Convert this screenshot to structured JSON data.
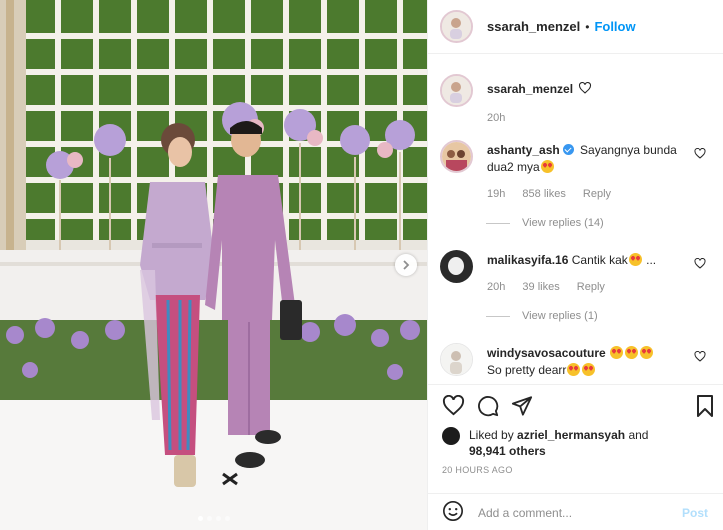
{
  "post": {
    "image_alt": "Photo of couple in lavender outfits in front of floral backdrop",
    "carousel": {
      "current": 1,
      "total": 4
    }
  },
  "header": {
    "username": "ssarah_menzel",
    "separator": "•",
    "follow_label": "Follow"
  },
  "caption": {
    "username": "ssarah_menzel",
    "time": "20h"
  },
  "comments": [
    {
      "username": "ashanty_ash",
      "verified": true,
      "text": "Sayangnya bunda dua2 mya",
      "time": "19h",
      "likes": "858 likes",
      "reply_label": "Reply",
      "view_replies": "View replies (14)"
    },
    {
      "username": "malikasyifa.16",
      "verified": false,
      "text": "Cantik kak",
      "time": "20h",
      "likes": "39 likes",
      "reply_label": "Reply",
      "view_replies": "View replies (1)"
    },
    {
      "username": "windysavosacouture",
      "verified": false,
      "text": "So pretty dearr",
      "time": "",
      "likes": "",
      "reply_label": "",
      "view_replies": ""
    }
  ],
  "likes": {
    "prefix": "Liked by",
    "by_user": "azriel_hermansyah",
    "and": "and",
    "count": "98,941 others"
  },
  "time_ago": "20 HOURS AGO",
  "add_comment": {
    "placeholder": "Add a comment...",
    "post_label": "Post"
  },
  "colors": {
    "follow": "#0095f6",
    "post_disabled": "#b2dffc",
    "muted": "#8e8e8e"
  },
  "icons": [
    "heart-icon",
    "comment-icon",
    "share-icon",
    "bookmark-icon",
    "emoji-icon",
    "chevron-right-icon",
    "verified-icon"
  ]
}
